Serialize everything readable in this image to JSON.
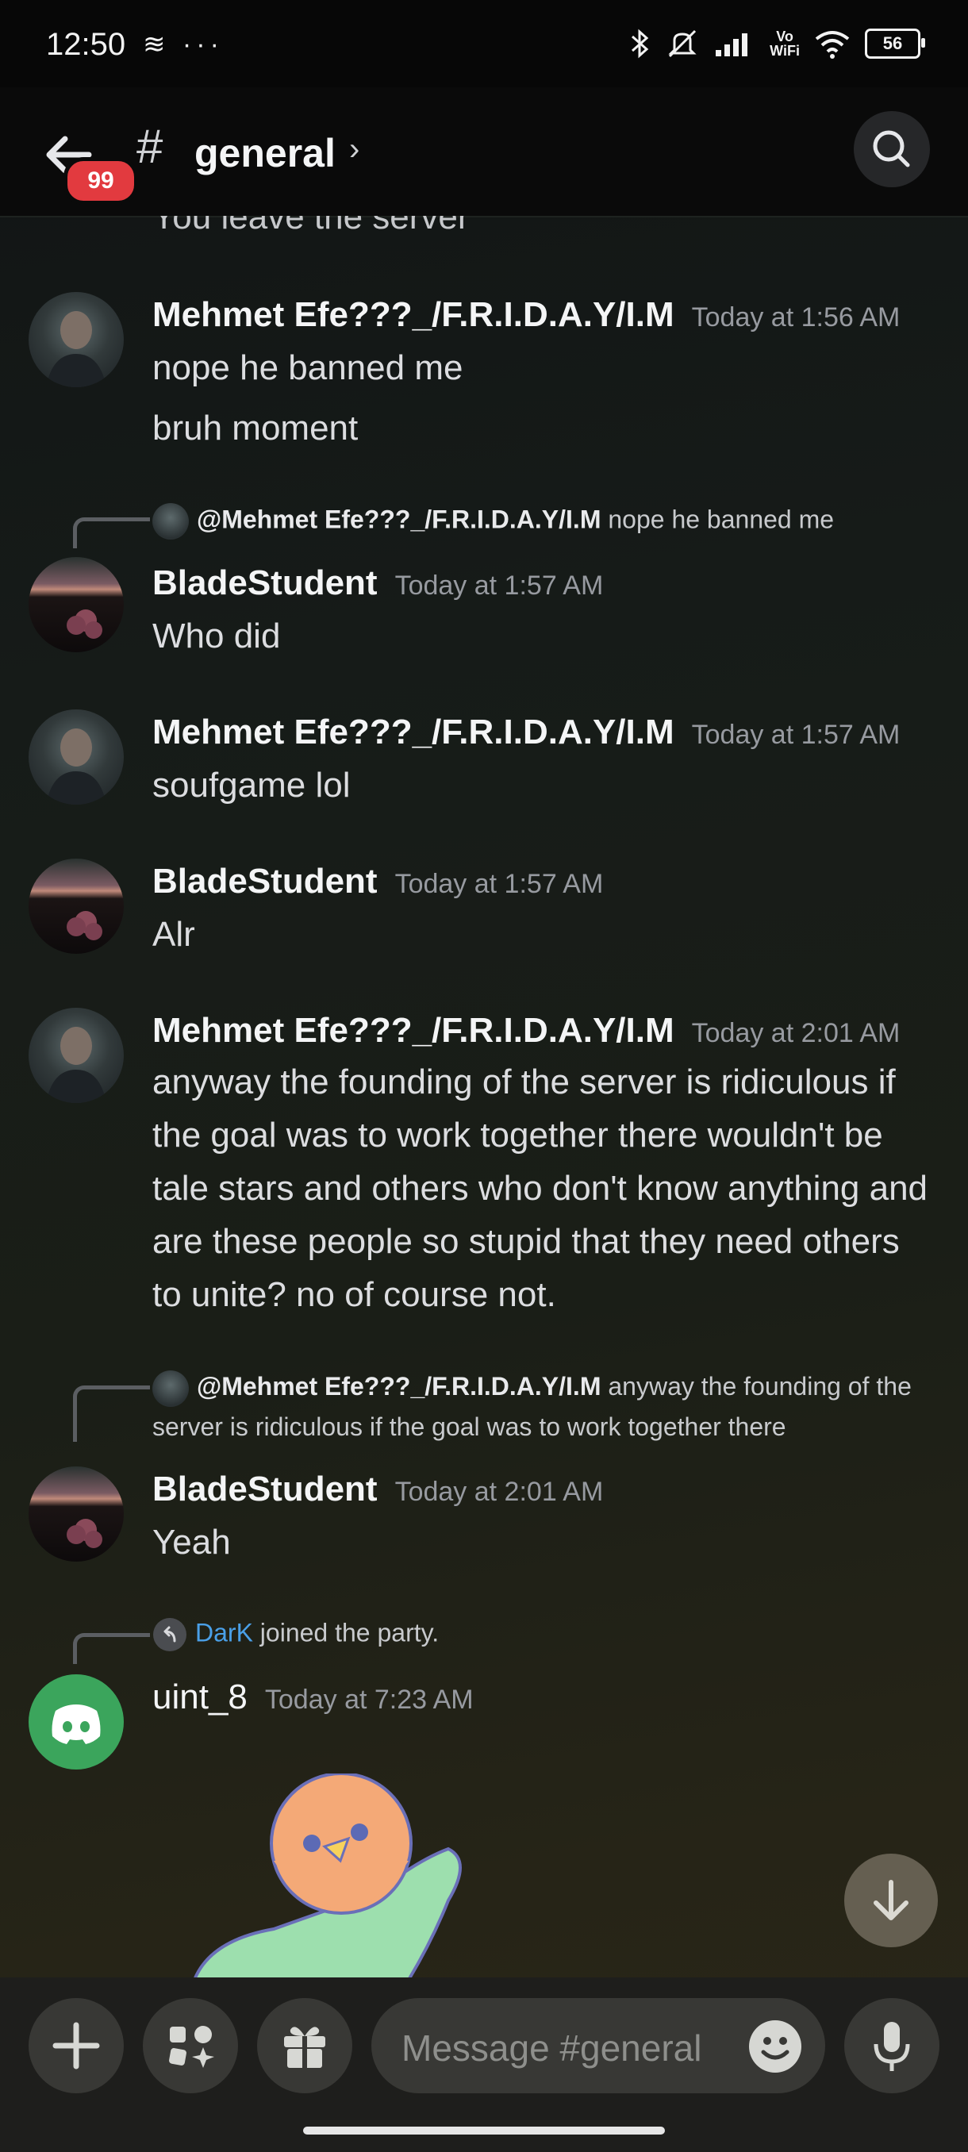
{
  "status_bar": {
    "time": "12:50",
    "left_icons": "≋ ···",
    "vowifi": "Vo\nWiFi",
    "battery": "56"
  },
  "header": {
    "badge_count": "99",
    "hash": "#",
    "channel": "general",
    "chevron": "›"
  },
  "cutoff_text": "You leave the server",
  "messages": [
    {
      "author": "Mehmet Efe???_/F.R.I.D.A.Y/I.M",
      "time": "Today at 1:56 AM",
      "lines": [
        "nope he banned me",
        "bruh moment"
      ]
    },
    {
      "reply_to": "@Mehmet Efe???_/F.R.I.D.A.Y/I.M",
      "reply_text": "nope he banned me",
      "author": "BladeStudent",
      "time": "Today at 1:57 AM",
      "lines": [
        "Who did"
      ]
    },
    {
      "author": "Mehmet Efe???_/F.R.I.D.A.Y/I.M",
      "time": "Today at 1:57 AM",
      "lines": [
        "soufgame lol"
      ]
    },
    {
      "author": "BladeStudent",
      "time": "Today at 1:57 AM",
      "lines": [
        "Alr"
      ]
    },
    {
      "author": "Mehmet Efe???_/F.R.I.D.A.Y/I.M",
      "time": "Today at 2:01 AM",
      "text": "anyway the founding of the server is ridiculous if the goal was to work together there wouldn't be tale stars and others who don't know anything and are these people so stupid that they need others to unite? no of course not."
    },
    {
      "reply_to": "@Mehmet Efe???_/F.R.I.D.A.Y/I.M",
      "reply_text": "anyway the founding of the server is ridiculous if the goal was to work together there",
      "author": "BladeStudent",
      "time": "Today at 2:01 AM",
      "lines": [
        "Yeah"
      ]
    },
    {
      "system_name": "DarK",
      "system_text": "joined the party.",
      "author": "uint_8",
      "time": "Today at 7:23 AM"
    }
  ],
  "input": {
    "placeholder": "Message #general"
  },
  "icons": {
    "back": "arrow-left",
    "search": "magnifier",
    "add": "plus",
    "apps": "apps",
    "gift": "gift",
    "emoji": "smiley",
    "mic": "microphone",
    "scroll": "arrow-down"
  },
  "colors": {
    "badge": "#e23a3f",
    "mention": "#4aa0e8",
    "discord_green": "#3ba55c"
  }
}
